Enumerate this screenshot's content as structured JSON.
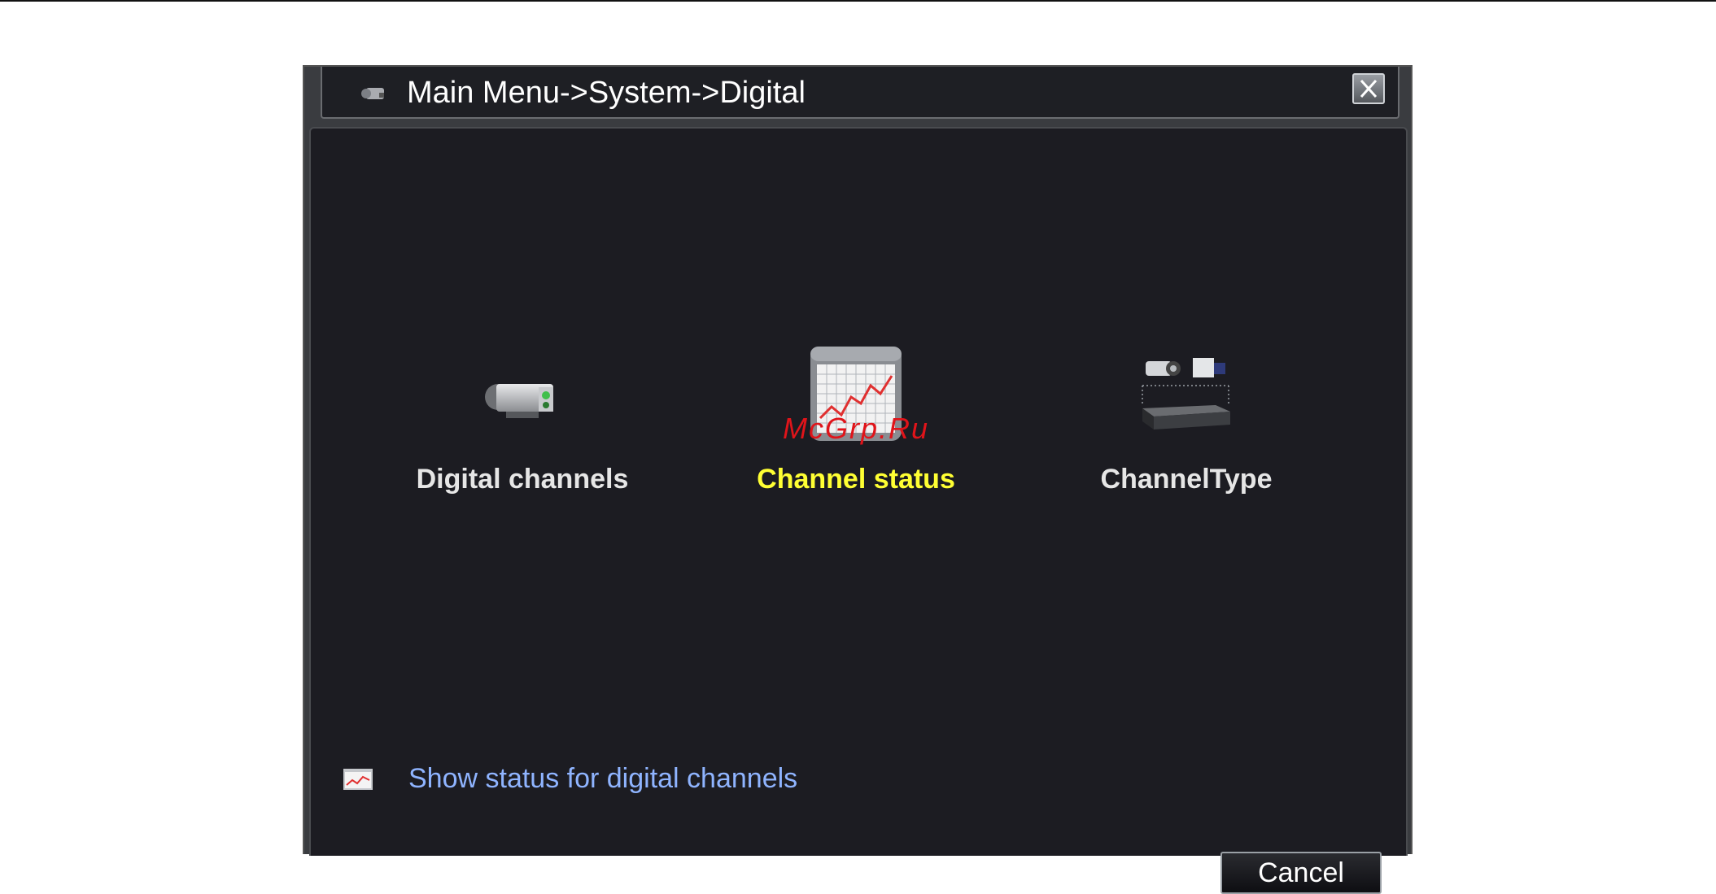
{
  "window": {
    "title": "Main Menu->System->Digital"
  },
  "menu": {
    "items": [
      {
        "label": "Digital channels",
        "icon": "camera-icon"
      },
      {
        "label": "Channel status",
        "icon": "chart-monitor-icon",
        "selected": true
      },
      {
        "label": "ChannelType",
        "icon": "camera-dvr-icon"
      }
    ]
  },
  "watermark": "McGrp.Ru",
  "status_bar": {
    "description": "Show status for digital channels",
    "icon": "chart-icon"
  },
  "footer": {
    "cancel_label": "Cancel"
  },
  "colors": {
    "background": "#1c1c22",
    "selected_label": "#ffff33",
    "label": "#e6e6e6",
    "status_text": "#8fb4ff",
    "watermark": "#e0141a"
  }
}
